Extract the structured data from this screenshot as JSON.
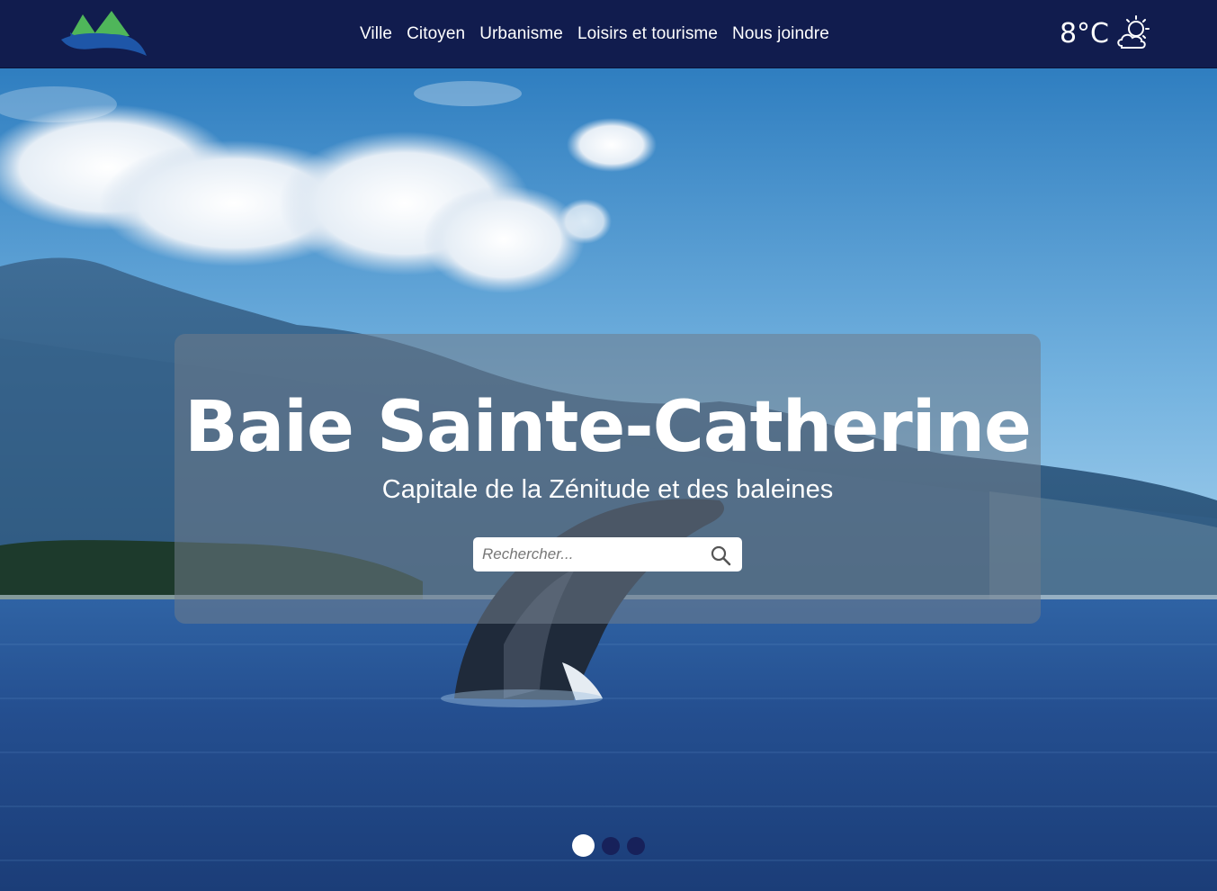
{
  "header": {
    "logo_icon": "mountain-whale-logo-icon",
    "nav": [
      {
        "label": "Ville"
      },
      {
        "label": "Citoyen"
      },
      {
        "label": "Urbanisme"
      },
      {
        "label": "Loisirs et tourisme"
      },
      {
        "label": "Nous joindre"
      }
    ],
    "weather": {
      "temperature": "8°C",
      "icon": "partly-cloudy-icon"
    }
  },
  "hero": {
    "title": "Baie Sainte-Catherine",
    "subtitle": "Capitale de la Zénitude et des baleines",
    "search": {
      "placeholder": "Rechercher...",
      "value": ""
    },
    "carousel": {
      "slide_count": 3,
      "active_index": 0
    }
  },
  "colors": {
    "header_bg": "#111c4e",
    "dot_inactive": "#17215a",
    "dot_active": "#ffffff",
    "overlay": "rgba(112,124,138,0.55)"
  }
}
